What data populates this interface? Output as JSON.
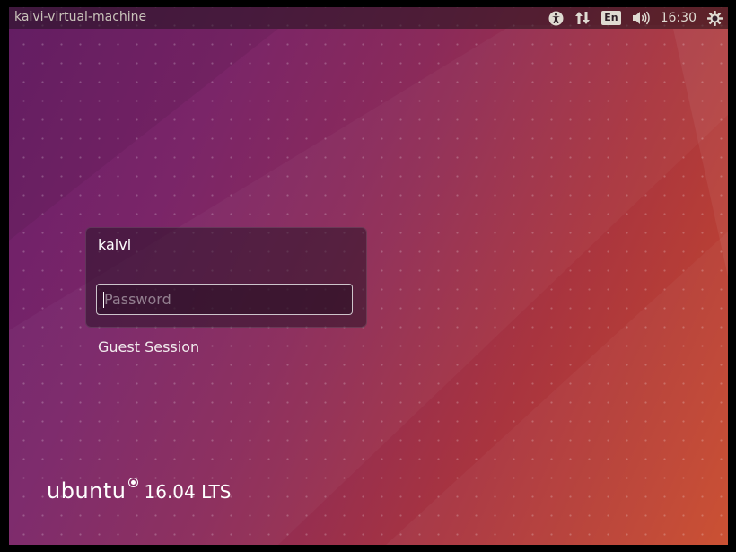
{
  "topbar": {
    "hostname": "kaivi-virtual-machine",
    "language": "En",
    "clock": "16:30",
    "icons": [
      "accessibility-icon",
      "network-icon",
      "volume-icon",
      "power-settings-icon"
    ]
  },
  "login": {
    "username": "kaivi",
    "password_placeholder": "Password",
    "password_value": ""
  },
  "guest_session_label": "Guest Session",
  "brand": {
    "name": "ubuntu",
    "version": "16.04 LTS"
  },
  "colors": {
    "bg_start": "#6a1f6a",
    "bg_end": "#c94a2b",
    "panel": "#1e121a",
    "panel_text": "#dfdbd2"
  }
}
